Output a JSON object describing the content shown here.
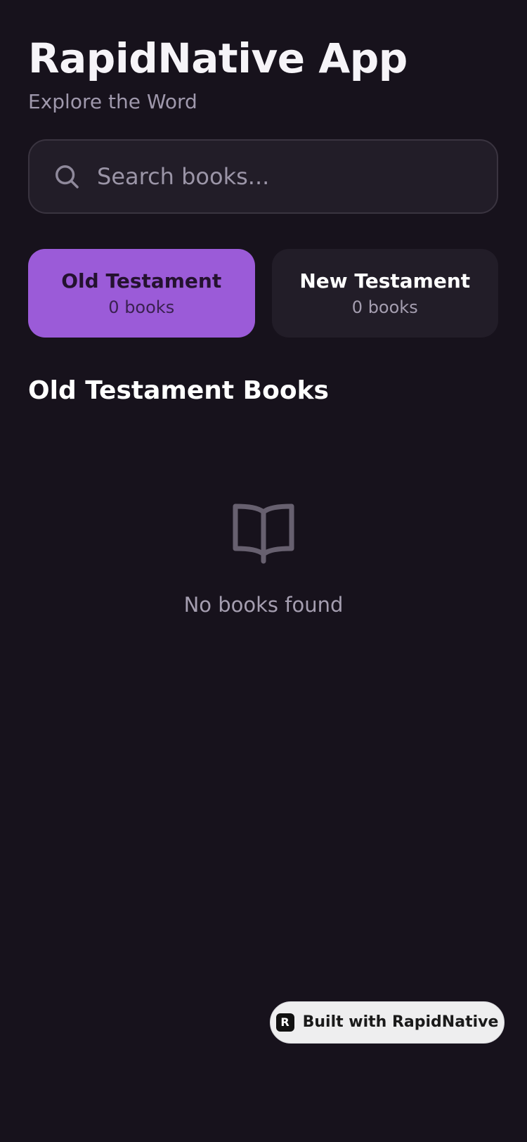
{
  "header": {
    "title": "RapidNative App",
    "subtitle": "Explore the Word"
  },
  "search": {
    "placeholder": "Search books...",
    "value": "",
    "icon": "search-icon"
  },
  "tabs": [
    {
      "label": "Old Testament",
      "count": "0 books",
      "active": true
    },
    {
      "label": "New Testament",
      "count": "0 books",
      "active": false
    }
  ],
  "section": {
    "title": "Old Testament Books"
  },
  "empty_state": {
    "icon": "book-open-icon",
    "message": "No books found"
  },
  "badge": {
    "label": "Built with RapidNative",
    "logo_letter": "R"
  },
  "colors": {
    "background": "#17121c",
    "surface": "#221d28",
    "accent": "#9b5bd8",
    "muted_text": "#a59eb0"
  }
}
